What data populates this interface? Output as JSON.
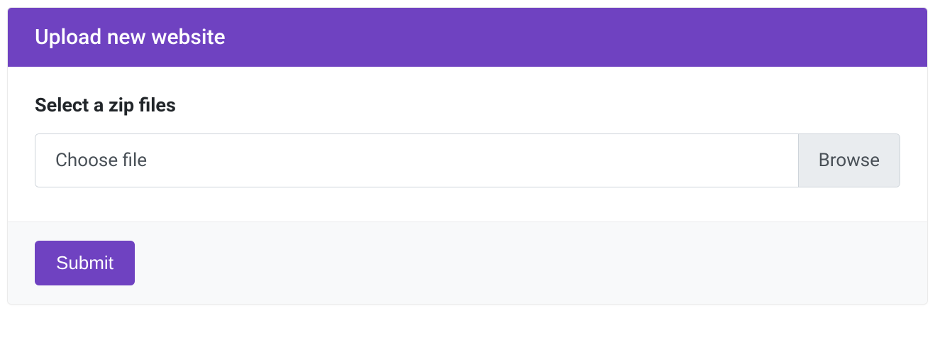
{
  "colors": {
    "primary": "#6f42c1",
    "footer_bg": "#f8f9fa",
    "browse_bg": "#e9ecef",
    "text": "#212529",
    "muted": "#495057"
  },
  "header": {
    "title": "Upload new website"
  },
  "form": {
    "label": "Select a zip files",
    "file_placeholder": "Choose file",
    "browse_label": "Browse"
  },
  "footer": {
    "submit_label": "Submit"
  }
}
